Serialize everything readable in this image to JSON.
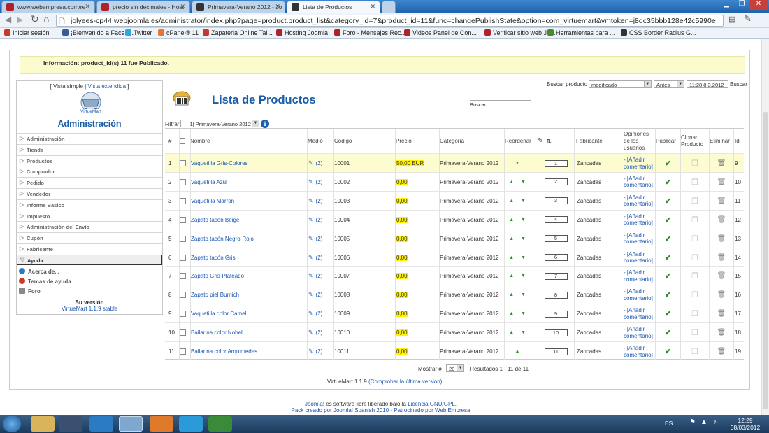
{
  "browser": {
    "tabs": [
      {
        "label": "www.webempresa.com/re"
      },
      {
        "label": "precio sin decimales - Host"
      },
      {
        "label": "Primavera-Verano 2012 - Jo"
      },
      {
        "label": "Lista de Productos"
      }
    ],
    "url": "jolyees-cp44.webjoomla.es/administrator/index.php?page=product.product_list&category_id=7&product_id=11&func=changePublishState&option=com_virtuemart&vmtoken=j8dc35bbb128e42c5990e",
    "bookmarks": [
      {
        "label": "Iniciar sesión",
        "color": "#c83a2a"
      },
      {
        "label": "¡Bienvenido a Faceb...",
        "color": "#3b5998"
      },
      {
        "label": "Twitter",
        "color": "#2aa8e0"
      },
      {
        "label": "cPanel® 11",
        "color": "#e8772e"
      },
      {
        "label": "Zapateria Online Tal...",
        "color": "#c23a2a"
      },
      {
        "label": "Hosting Joomla",
        "color": "#b0222a"
      },
      {
        "label": "Foro - Mensajes Rec...",
        "color": "#b0222a"
      },
      {
        "label": "Videos Panel de Con...",
        "color": "#b0222a"
      },
      {
        "label": "Verificar sitio web Jo...",
        "color": "#b0222a"
      },
      {
        "label": "Herramientas para ...",
        "color": "#4a8a2a"
      },
      {
        "label": "CSS Border Radius G...",
        "color": "#333333"
      }
    ]
  },
  "message": "Información: product_id(s) 11 fue Publicado.",
  "sidebar": {
    "vista_simple": "[ Vista simple |",
    "vista_extendida": "Vista extendida",
    "vista_close": "]",
    "logo_text": "VirtueMart",
    "title": "Administración",
    "menu": [
      "Administración",
      "Tienda",
      "Productos",
      "Comprador",
      "Pedido",
      "Vendedor",
      "Informe Basico",
      "Impuesto",
      "Administración del Envío",
      "Cupón",
      "Fabricante"
    ],
    "open_menu": "Ayuda",
    "sub_items": [
      "Acerca de...",
      "Temas de ayuda",
      "Foro"
    ],
    "version_title": "Su versión",
    "version_value": "VirtueMart 1.1.9 stable"
  },
  "main": {
    "title": "Lista de Productos",
    "search_button": "Buscar",
    "buscar_producto": "Buscar producto",
    "filter_select": "modificado",
    "date_select": "Antes",
    "date_value": "11:28 8.3.2012",
    "buscar2": "Buscar",
    "filtrar_label": "Filtrar:",
    "filtrar_value": "—|1| Primavera-Verano 2012"
  },
  "table": {
    "headers": {
      "num": "#",
      "nombre": "Nombre",
      "medio": "Medio",
      "codigo": "Código",
      "precio": "Precio",
      "categoria": "Categoría",
      "reordenar": "Reordenar",
      "fabricante": "Fabricante",
      "opiniones": "Opiniones de los usuarios",
      "publicar": "Publicar",
      "clonar": "Clonar Producto",
      "eliminar": "Eliminar",
      "id": "Id"
    },
    "rows": [
      {
        "n": "1",
        "name": "Vaquetilla Gris-Colores",
        "medio": "(2)",
        "code": "10001",
        "price": "50,00 EUR",
        "cat": "Primavera-Verano 2012",
        "order": "1",
        "fab": "Zancadas",
        "op": "- [Añadir comentario]",
        "id": "9",
        "arrows": "▼"
      },
      {
        "n": "2",
        "name": "Vaquetilla Azul",
        "medio": "(2)",
        "code": "10002",
        "price": "0,00",
        "cat": "Primavera-Verano 2012",
        "order": "2",
        "fab": "Zancadas",
        "op": "- [Añadir comentario]",
        "id": "10",
        "arrows": "▲▼"
      },
      {
        "n": "3",
        "name": "Vaquetilla Marrón",
        "medio": "(2)",
        "code": "10003",
        "price": "0,00",
        "cat": "Primavera-Verano 2012",
        "order": "3",
        "fab": "Zancadas",
        "op": "- [Añadir comentario]",
        "id": "11",
        "arrows": "▲▼"
      },
      {
        "n": "4",
        "name": "Zapato tacón Beige",
        "medio": "(2)",
        "code": "10004",
        "price": "0,00",
        "cat": "Primavera-Verano 2012",
        "order": "4",
        "fab": "Zancadas",
        "op": "- [Añadir comentario]",
        "id": "12",
        "arrows": "▲▼"
      },
      {
        "n": "5",
        "name": "Zapato tacón Negro-Rojo",
        "medio": "(2)",
        "code": "10005",
        "price": "0,00",
        "cat": "Primavera-Verano 2012",
        "order": "5",
        "fab": "Zancadas",
        "op": "- [Añadir comentario]",
        "id": "13",
        "arrows": "▲▼"
      },
      {
        "n": "6",
        "name": "Zapato tacón Gris",
        "medio": "(2)",
        "code": "10006",
        "price": "0,00",
        "cat": "Primavera-Verano 2012",
        "order": "6",
        "fab": "Zancadas",
        "op": "- [Añadir comentario]",
        "id": "14",
        "arrows": "▲▼"
      },
      {
        "n": "7",
        "name": "Zapato Gris-Plateado",
        "medio": "(2)",
        "code": "10007",
        "price": "0,00",
        "cat": "Primavera-Verano 2012",
        "order": "7",
        "fab": "Zancadas",
        "op": "- [Añadir comentario]",
        "id": "15",
        "arrows": "▲▼"
      },
      {
        "n": "8",
        "name": "Zapato piel Burnich",
        "medio": "(2)",
        "code": "10008",
        "price": "0,00",
        "cat": "Primavera-Verano 2012",
        "order": "8",
        "fab": "Zancadas",
        "op": "- [Añadir comentario]",
        "id": "16",
        "arrows": "▲▼"
      },
      {
        "n": "9",
        "name": "Vaquetilla color Camel",
        "medio": "(2)",
        "code": "10009",
        "price": "0,00",
        "cat": "Primavera-Verano 2012",
        "order": "9",
        "fab": "Zancadas",
        "op": "- [Añadir comentario]",
        "id": "17",
        "arrows": "▲▼"
      },
      {
        "n": "10",
        "name": "Bailarina color Nobel",
        "medio": "(2)",
        "code": "10010",
        "price": "0,00",
        "cat": "Primavera-Verano 2012",
        "order": "10",
        "fab": "Zancadas",
        "op": "- [Añadir comentario]",
        "id": "18",
        "arrows": "▲▼"
      },
      {
        "n": "11",
        "name": "Bailarina color Arquimedes",
        "medio": "(2)",
        "code": "10011",
        "price": "0,00",
        "cat": "Primavera-Verano 2012",
        "order": "11",
        "fab": "Zancadas",
        "op": "- [Añadir comentario]",
        "id": "19",
        "arrows": "▲"
      }
    ]
  },
  "footer": {
    "mostrar": "Mostrar #",
    "mostrar_value": "20",
    "resultados": "Resultados 1 - 11 de 11",
    "vm_version": "VirtueMart 1.1.9",
    "vm_check": "(Comprobar la última versión)",
    "joomla_link": "Joomla!",
    "joomla_text": " es software libre liberado bajo la ",
    "license": "Licencia GNU/GPL.",
    "pack_text": "Pack creado por ",
    "pack_link": "Joomla! Spanish 2010 - Patrocinado por Web Empresa"
  },
  "taskbar": {
    "lang": "ES",
    "time": "12:29",
    "date": "08/03/2012"
  }
}
